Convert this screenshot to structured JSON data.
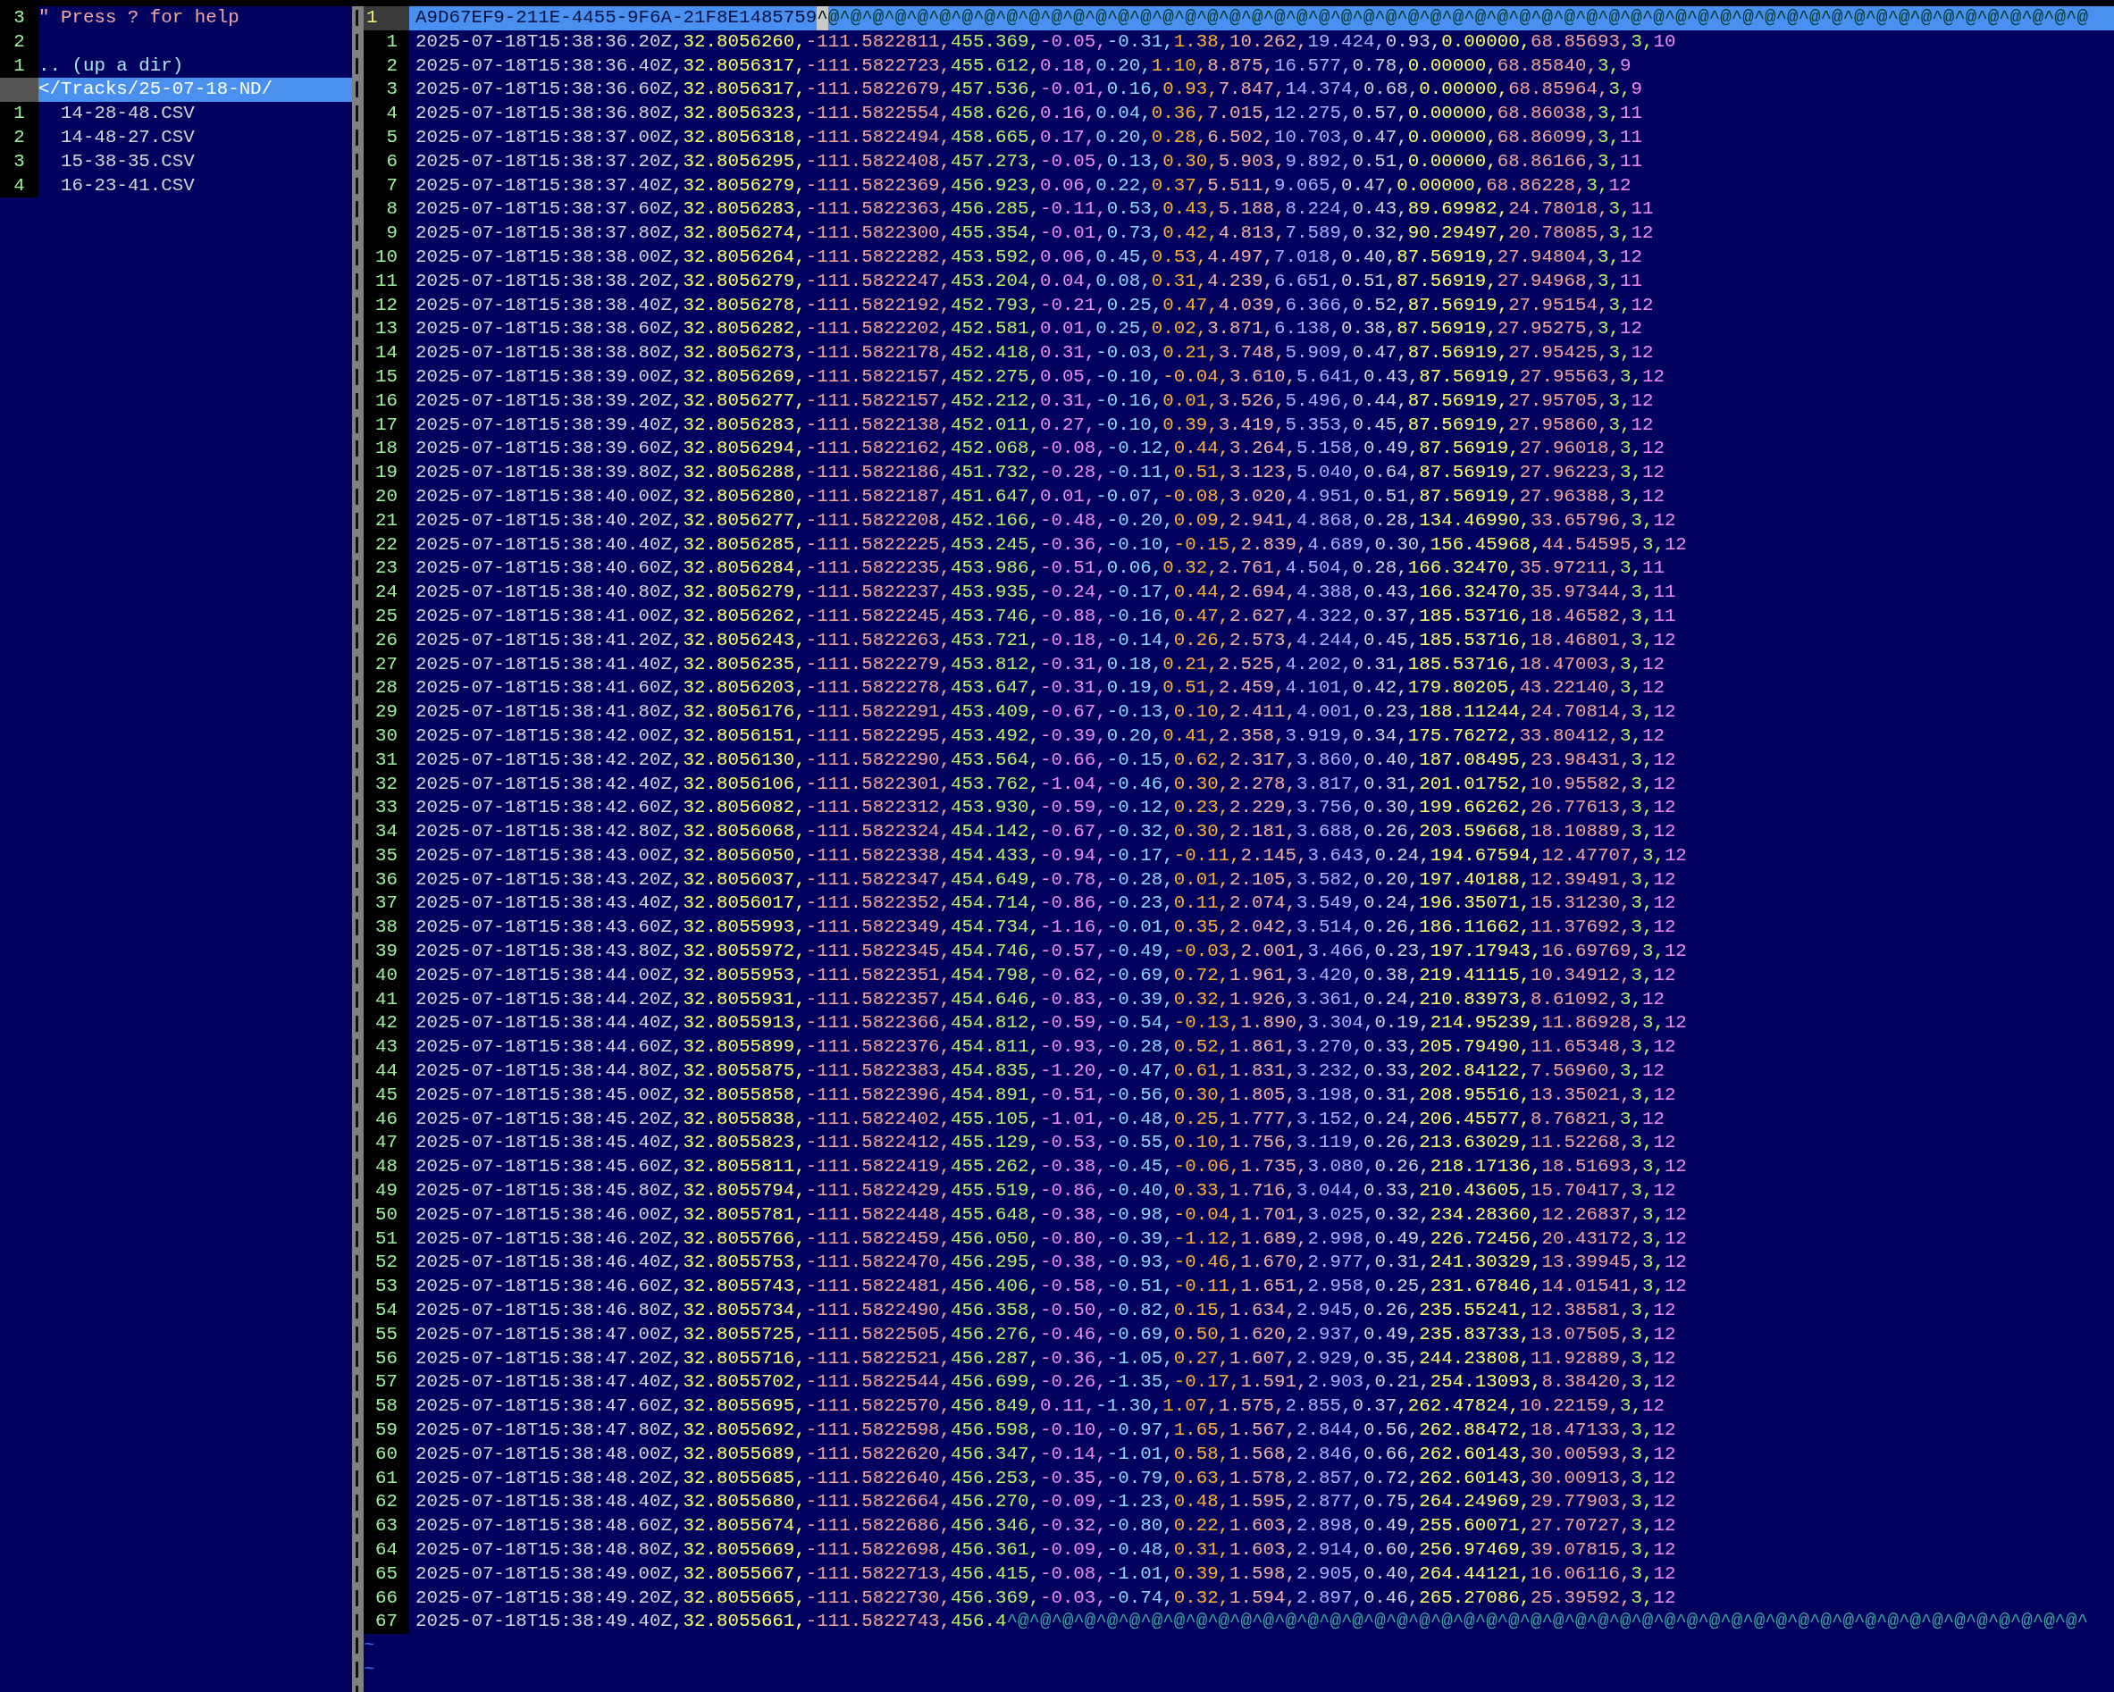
{
  "file_browser": {
    "lines": [
      {
        "number": "3",
        "kind": "comment",
        "text": "\" Press ? for help"
      },
      {
        "number": "2",
        "kind": "blank"
      },
      {
        "number": "1",
        "kind": "updir",
        "text": ".. (up a dir)"
      },
      {
        "kind": "current",
        "text": "</Tracks/25-07-18-ND/"
      },
      {
        "number": "1",
        "kind": "file",
        "text": "14-28-48.CSV"
      },
      {
        "number": "2",
        "kind": "file",
        "text": "14-48-27.CSV"
      },
      {
        "number": "3",
        "kind": "file",
        "text": "15-38-35.CSV"
      },
      {
        "number": "4",
        "kind": "file",
        "text": "16-23-41.CSV"
      }
    ]
  },
  "editor": {
    "header_line": {
      "number": "1",
      "text": "A9D67EF9-211E-4455-9F6A-21F8E1485759",
      "cursor": "^",
      "trailing": "@^@^@^@^@^@^@^@^@^@^@^@^@^@^@^@^@^@^@^@^@^@^@^@^@^@^@^@^@^@^@^@^@^@^@^@^@^@^@^@^@^@^@^@^@^@^@^@^@^@^@^@^@^@^@^@^@"
    },
    "rows": [
      {
        "number": "1",
        "text": "2025-07-18T15:38:36.20Z,32.8056260,-111.5822811,455.369,-0.05,-0.31,1.38,10.262,19.424,0.93,0.00000,68.85693,3,10"
      },
      {
        "number": "2",
        "text": "2025-07-18T15:38:36.40Z,32.8056317,-111.5822723,455.612,0.18,0.20,1.10,8.875,16.577,0.78,0.00000,68.85840,3,9"
      },
      {
        "number": "3",
        "text": "2025-07-18T15:38:36.60Z,32.8056317,-111.5822679,457.536,-0.01,0.16,0.93,7.847,14.374,0.68,0.00000,68.85964,3,9"
      },
      {
        "number": "4",
        "text": "2025-07-18T15:38:36.80Z,32.8056323,-111.5822554,458.626,0.16,0.04,0.36,7.015,12.275,0.57,0.00000,68.86038,3,11"
      },
      {
        "number": "5",
        "text": "2025-07-18T15:38:37.00Z,32.8056318,-111.5822494,458.665,0.17,0.20,0.28,6.502,10.703,0.47,0.00000,68.86099,3,11"
      },
      {
        "number": "6",
        "text": "2025-07-18T15:38:37.20Z,32.8056295,-111.5822408,457.273,-0.05,0.13,0.30,5.903,9.892,0.51,0.00000,68.86166,3,11"
      },
      {
        "number": "7",
        "text": "2025-07-18T15:38:37.40Z,32.8056279,-111.5822369,456.923,0.06,0.22,0.37,5.511,9.065,0.47,0.00000,68.86228,3,12"
      },
      {
        "number": "8",
        "text": "2025-07-18T15:38:37.60Z,32.8056283,-111.5822363,456.285,-0.11,0.53,0.43,5.188,8.224,0.43,89.69982,24.78018,3,11"
      },
      {
        "number": "9",
        "text": "2025-07-18T15:38:37.80Z,32.8056274,-111.5822300,455.354,-0.01,0.73,0.42,4.813,7.589,0.32,90.29497,20.78085,3,12"
      },
      {
        "number": "10",
        "text": "2025-07-18T15:38:38.00Z,32.8056264,-111.5822282,453.592,0.06,0.45,0.53,4.497,7.018,0.40,87.56919,27.94804,3,12"
      },
      {
        "number": "11",
        "text": "2025-07-18T15:38:38.20Z,32.8056279,-111.5822247,453.204,0.04,0.08,0.31,4.239,6.651,0.51,87.56919,27.94968,3,11"
      },
      {
        "number": "12",
        "text": "2025-07-18T15:38:38.40Z,32.8056278,-111.5822192,452.793,-0.21,0.25,0.47,4.039,6.366,0.52,87.56919,27.95154,3,12"
      },
      {
        "number": "13",
        "text": "2025-07-18T15:38:38.60Z,32.8056282,-111.5822202,452.581,0.01,0.25,0.02,3.871,6.138,0.38,87.56919,27.95275,3,12"
      },
      {
        "number": "14",
        "text": "2025-07-18T15:38:38.80Z,32.8056273,-111.5822178,452.418,0.31,-0.03,0.21,3.748,5.909,0.47,87.56919,27.95425,3,12"
      },
      {
        "number": "15",
        "text": "2025-07-18T15:38:39.00Z,32.8056269,-111.5822157,452.275,0.05,-0.10,-0.04,3.610,5.641,0.43,87.56919,27.95563,3,12"
      },
      {
        "number": "16",
        "text": "2025-07-18T15:38:39.20Z,32.8056277,-111.5822157,452.212,0.31,-0.16,0.01,3.526,5.496,0.44,87.56919,27.95705,3,12"
      },
      {
        "number": "17",
        "text": "2025-07-18T15:38:39.40Z,32.8056283,-111.5822138,452.011,0.27,-0.10,0.39,3.419,5.353,0.45,87.56919,27.95860,3,12"
      },
      {
        "number": "18",
        "text": "2025-07-18T15:38:39.60Z,32.8056294,-111.5822162,452.068,-0.08,-0.12,0.44,3.264,5.158,0.49,87.56919,27.96018,3,12"
      },
      {
        "number": "19",
        "text": "2025-07-18T15:38:39.80Z,32.8056288,-111.5822186,451.732,-0.28,-0.11,0.51,3.123,5.040,0.64,87.56919,27.96223,3,12"
      },
      {
        "number": "20",
        "text": "2025-07-18T15:38:40.00Z,32.8056280,-111.5822187,451.647,0.01,-0.07,-0.08,3.020,4.951,0.51,87.56919,27.96388,3,12"
      },
      {
        "number": "21",
        "text": "2025-07-18T15:38:40.20Z,32.8056277,-111.5822208,452.166,-0.48,-0.20,0.09,2.941,4.868,0.28,134.46990,33.65796,3,12"
      },
      {
        "number": "22",
        "text": "2025-07-18T15:38:40.40Z,32.8056285,-111.5822225,453.245,-0.36,-0.10,-0.15,2.839,4.689,0.30,156.45968,44.54595,3,12"
      },
      {
        "number": "23",
        "text": "2025-07-18T15:38:40.60Z,32.8056284,-111.5822235,453.986,-0.51,0.06,0.32,2.761,4.504,0.28,166.32470,35.97211,3,11"
      },
      {
        "number": "24",
        "text": "2025-07-18T15:38:40.80Z,32.8056279,-111.5822237,453.935,-0.24,-0.17,0.44,2.694,4.388,0.43,166.32470,35.97344,3,11"
      },
      {
        "number": "25",
        "text": "2025-07-18T15:38:41.00Z,32.8056262,-111.5822245,453.746,-0.88,-0.16,0.47,2.627,4.322,0.37,185.53716,18.46582,3,11"
      },
      {
        "number": "26",
        "text": "2025-07-18T15:38:41.20Z,32.8056243,-111.5822263,453.721,-0.18,-0.14,0.26,2.573,4.244,0.45,185.53716,18.46801,3,12"
      },
      {
        "number": "27",
        "text": "2025-07-18T15:38:41.40Z,32.8056235,-111.5822279,453.812,-0.31,0.18,0.21,2.525,4.202,0.31,185.53716,18.47003,3,12"
      },
      {
        "number": "28",
        "text": "2025-07-18T15:38:41.60Z,32.8056203,-111.5822278,453.647,-0.31,0.19,0.51,2.459,4.101,0.42,179.80205,43.22140,3,12"
      },
      {
        "number": "29",
        "text": "2025-07-18T15:38:41.80Z,32.8056176,-111.5822291,453.409,-0.67,-0.13,0.10,2.411,4.001,0.23,188.11244,24.70814,3,12"
      },
      {
        "number": "30",
        "text": "2025-07-18T15:38:42.00Z,32.8056151,-111.5822295,453.492,-0.39,0.20,0.41,2.358,3.919,0.34,175.76272,33.80412,3,12"
      },
      {
        "number": "31",
        "text": "2025-07-18T15:38:42.20Z,32.8056130,-111.5822290,453.564,-0.66,-0.15,0.62,2.317,3.860,0.40,187.08495,23.98431,3,12"
      },
      {
        "number": "32",
        "text": "2025-07-18T15:38:42.40Z,32.8056106,-111.5822301,453.762,-1.04,-0.46,0.30,2.278,3.817,0.31,201.01752,10.95582,3,12"
      },
      {
        "number": "33",
        "text": "2025-07-18T15:38:42.60Z,32.8056082,-111.5822312,453.930,-0.59,-0.12,0.23,2.229,3.756,0.30,199.66262,26.77613,3,12"
      },
      {
        "number": "34",
        "text": "2025-07-18T15:38:42.80Z,32.8056068,-111.5822324,454.142,-0.67,-0.32,0.30,2.181,3.688,0.26,203.59668,18.10889,3,12"
      },
      {
        "number": "35",
        "text": "2025-07-18T15:38:43.00Z,32.8056050,-111.5822338,454.433,-0.94,-0.17,-0.11,2.145,3.643,0.24,194.67594,12.47707,3,12"
      },
      {
        "number": "36",
        "text": "2025-07-18T15:38:43.20Z,32.8056037,-111.5822347,454.649,-0.78,-0.28,0.01,2.105,3.582,0.20,197.40188,12.39491,3,12"
      },
      {
        "number": "37",
        "text": "2025-07-18T15:38:43.40Z,32.8056017,-111.5822352,454.714,-0.86,-0.23,0.11,2.074,3.549,0.24,196.35071,15.31230,3,12"
      },
      {
        "number": "38",
        "text": "2025-07-18T15:38:43.60Z,32.8055993,-111.5822349,454.734,-1.16,-0.01,0.35,2.042,3.514,0.26,186.11662,11.37692,3,12"
      },
      {
        "number": "39",
        "text": "2025-07-18T15:38:43.80Z,32.8055972,-111.5822345,454.746,-0.57,-0.49,-0.03,2.001,3.466,0.23,197.17943,16.69769,3,12"
      },
      {
        "number": "40",
        "text": "2025-07-18T15:38:44.00Z,32.8055953,-111.5822351,454.798,-0.62,-0.69,0.72,1.961,3.420,0.38,219.41115,10.34912,3,12"
      },
      {
        "number": "41",
        "text": "2025-07-18T15:38:44.20Z,32.8055931,-111.5822357,454.646,-0.83,-0.39,0.32,1.926,3.361,0.24,210.83973,8.61092,3,12"
      },
      {
        "number": "42",
        "text": "2025-07-18T15:38:44.40Z,32.8055913,-111.5822366,454.812,-0.59,-0.54,-0.13,1.890,3.304,0.19,214.95239,11.86928,3,12"
      },
      {
        "number": "43",
        "text": "2025-07-18T15:38:44.60Z,32.8055899,-111.5822376,454.811,-0.93,-0.28,0.52,1.861,3.270,0.33,205.79490,11.65348,3,12"
      },
      {
        "number": "44",
        "text": "2025-07-18T15:38:44.80Z,32.8055875,-111.5822383,454.835,-1.20,-0.47,0.61,1.831,3.232,0.33,202.84122,7.56960,3,12"
      },
      {
        "number": "45",
        "text": "2025-07-18T15:38:45.00Z,32.8055858,-111.5822396,454.891,-0.51,-0.56,0.30,1.805,3.198,0.31,208.95516,13.35021,3,12"
      },
      {
        "number": "46",
        "text": "2025-07-18T15:38:45.20Z,32.8055838,-111.5822402,455.105,-1.01,-0.48,0.25,1.777,3.152,0.24,206.45577,8.76821,3,12"
      },
      {
        "number": "47",
        "text": "2025-07-18T15:38:45.40Z,32.8055823,-111.5822412,455.129,-0.53,-0.55,0.10,1.756,3.119,0.26,213.63029,11.52268,3,12"
      },
      {
        "number": "48",
        "text": "2025-07-18T15:38:45.60Z,32.8055811,-111.5822419,455.262,-0.38,-0.45,-0.06,1.735,3.080,0.26,218.17136,18.51693,3,12"
      },
      {
        "number": "49",
        "text": "2025-07-18T15:38:45.80Z,32.8055794,-111.5822429,455.519,-0.86,-0.40,0.33,1.716,3.044,0.33,210.43605,15.70417,3,12"
      },
      {
        "number": "50",
        "text": "2025-07-18T15:38:46.00Z,32.8055781,-111.5822448,455.648,-0.38,-0.98,-0.04,1.701,3.025,0.32,234.28360,12.26837,3,12"
      },
      {
        "number": "51",
        "text": "2025-07-18T15:38:46.20Z,32.8055766,-111.5822459,456.050,-0.80,-0.39,-1.12,1.689,2.998,0.49,226.72456,20.43172,3,12"
      },
      {
        "number": "52",
        "text": "2025-07-18T15:38:46.40Z,32.8055753,-111.5822470,456.295,-0.38,-0.93,-0.46,1.670,2.977,0.31,241.30329,13.39945,3,12"
      },
      {
        "number": "53",
        "text": "2025-07-18T15:38:46.60Z,32.8055743,-111.5822481,456.406,-0.58,-0.51,-0.11,1.651,2.958,0.25,231.67846,14.01541,3,12"
      },
      {
        "number": "54",
        "text": "2025-07-18T15:38:46.80Z,32.8055734,-111.5822490,456.358,-0.50,-0.82,0.15,1.634,2.945,0.26,235.55241,12.38581,3,12"
      },
      {
        "number": "55",
        "text": "2025-07-18T15:38:47.00Z,32.8055725,-111.5822505,456.276,-0.46,-0.69,0.50,1.620,2.937,0.49,235.83733,13.07505,3,12"
      },
      {
        "number": "56",
        "text": "2025-07-18T15:38:47.20Z,32.8055716,-111.5822521,456.287,-0.36,-1.05,0.27,1.607,2.929,0.35,244.23808,11.92889,3,12"
      },
      {
        "number": "57",
        "text": "2025-07-18T15:38:47.40Z,32.8055702,-111.5822544,456.699,-0.26,-1.35,-0.17,1.591,2.903,0.21,254.13093,8.38420,3,12"
      },
      {
        "number": "58",
        "text": "2025-07-18T15:38:47.60Z,32.8055695,-111.5822570,456.849,0.11,-1.30,1.07,1.575,2.855,0.37,262.47824,10.22159,3,12"
      },
      {
        "number": "59",
        "text": "2025-07-18T15:38:47.80Z,32.8055692,-111.5822598,456.598,-0.10,-0.97,1.65,1.567,2.844,0.56,262.88472,18.47133,3,12"
      },
      {
        "number": "60",
        "text": "2025-07-18T15:38:48.00Z,32.8055689,-111.5822620,456.347,-0.14,-1.01,0.58,1.568,2.846,0.66,262.60143,30.00593,3,12"
      },
      {
        "number": "61",
        "text": "2025-07-18T15:38:48.20Z,32.8055685,-111.5822640,456.253,-0.35,-0.79,0.63,1.578,2.857,0.72,262.60143,30.00913,3,12"
      },
      {
        "number": "62",
        "text": "2025-07-18T15:38:48.40Z,32.8055680,-111.5822664,456.270,-0.09,-1.23,0.48,1.595,2.877,0.75,264.24969,29.77903,3,12"
      },
      {
        "number": "63",
        "text": "2025-07-18T15:38:48.60Z,32.8055674,-111.5822686,456.346,-0.32,-0.80,0.22,1.603,2.898,0.49,255.60071,27.70727,3,12"
      },
      {
        "number": "64",
        "text": "2025-07-18T15:38:48.80Z,32.8055669,-111.5822698,456.361,-0.09,-0.48,0.31,1.603,2.914,0.60,256.97469,39.07815,3,12"
      },
      {
        "number": "65",
        "text": "2025-07-18T15:38:49.00Z,32.8055667,-111.5822713,456.415,-0.08,-1.01,0.39,1.598,2.905,0.40,264.44121,16.06116,3,12"
      },
      {
        "number": "66",
        "text": "2025-07-18T15:38:49.20Z,32.8055665,-111.5822730,456.369,-0.03,-0.74,0.32,1.594,2.897,0.46,265.27086,25.39592,3,12"
      },
      {
        "number": "67",
        "text": "2025-07-18T15:38:49.40Z,32.8055661,-111.5822743,456.4",
        "trailing": "^@^@^@^@^@^@^@^@^@^@^@^@^@^@^@^@^@^@^@^@^@^@^@^@^@^@^@^@^@^@^@^@^@^@^@^@^@^@^@^@^@^@^@^@^@^@^@^@^"
      }
    ],
    "empty_lines": [
      "~",
      "~"
    ]
  }
}
